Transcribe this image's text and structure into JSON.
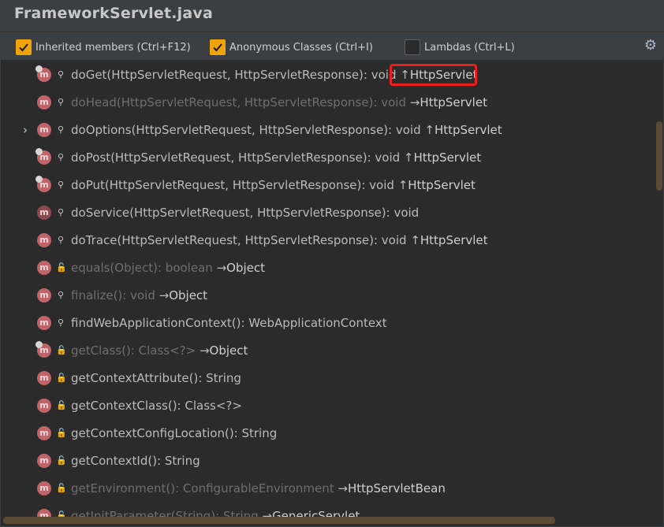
{
  "window": {
    "title": "FrameworkServlet.java"
  },
  "options": [
    {
      "label": "Inherited members (Ctrl+F12)",
      "checked": true
    },
    {
      "label": "Anonymous Classes (Ctrl+I)",
      "checked": true
    },
    {
      "label": "Lambdas (Ctrl+L)",
      "checked": false
    }
  ],
  "settings_icon": "gear-icon",
  "colors": {
    "checkbox_on": "#f0a30a",
    "method_icon": "#c1646a",
    "public_icon": "#62b543",
    "highlight_border": "#e8201e"
  },
  "members": [
    {
      "sig": "doGet(HttpServletRequest, HttpServletResponse): void ",
      "arrow": "↑",
      "owner": "HttpServlet",
      "inherited": false,
      "visibility": "protected",
      "expand": false,
      "override": true
    },
    {
      "sig": "doHead(HttpServletRequest, HttpServletResponse): void ",
      "arrow": "→",
      "owner": "HttpServlet",
      "inherited": true,
      "visibility": "protected",
      "expand": false,
      "override": false
    },
    {
      "sig": "doOptions(HttpServletRequest, HttpServletResponse): void ",
      "arrow": "↑",
      "owner": "HttpServlet",
      "inherited": false,
      "visibility": "protected",
      "expand": true,
      "override": false
    },
    {
      "sig": "doPost(HttpServletRequest, HttpServletResponse): void ",
      "arrow": "↑",
      "owner": "HttpServlet",
      "inherited": false,
      "visibility": "protected",
      "expand": false,
      "override": true
    },
    {
      "sig": "doPut(HttpServletRequest, HttpServletResponse): void ",
      "arrow": "↑",
      "owner": "HttpServlet",
      "inherited": false,
      "visibility": "protected",
      "expand": false,
      "override": true
    },
    {
      "sig": "doService(HttpServletRequest, HttpServletResponse): void",
      "arrow": "",
      "owner": "",
      "inherited": false,
      "visibility": "protected",
      "expand": false,
      "override": false,
      "abstract": true
    },
    {
      "sig": "doTrace(HttpServletRequest, HttpServletResponse): void ",
      "arrow": "↑",
      "owner": "HttpServlet",
      "inherited": false,
      "visibility": "protected",
      "expand": false,
      "override": false
    },
    {
      "sig": "equals(Object): boolean ",
      "arrow": "→",
      "owner": "Object",
      "inherited": true,
      "visibility": "public",
      "expand": false,
      "override": false
    },
    {
      "sig": "finalize(): void ",
      "arrow": "→",
      "owner": "Object",
      "inherited": true,
      "visibility": "protected",
      "expand": false,
      "override": false
    },
    {
      "sig": "findWebApplicationContext(): WebApplicationContext",
      "arrow": "",
      "owner": "",
      "inherited": false,
      "visibility": "protected",
      "expand": false,
      "override": false
    },
    {
      "sig": "getClass(): Class<?> ",
      "arrow": "→",
      "owner": "Object",
      "inherited": true,
      "visibility": "public",
      "expand": false,
      "override": true
    },
    {
      "sig": "getContextAttribute(): String",
      "arrow": "",
      "owner": "",
      "inherited": false,
      "visibility": "public",
      "expand": false,
      "override": false
    },
    {
      "sig": "getContextClass(): Class<?>",
      "arrow": "",
      "owner": "",
      "inherited": false,
      "visibility": "public",
      "expand": false,
      "override": false
    },
    {
      "sig": "getContextConfigLocation(): String",
      "arrow": "",
      "owner": "",
      "inherited": false,
      "visibility": "public",
      "expand": false,
      "override": false
    },
    {
      "sig": "getContextId(): String",
      "arrow": "",
      "owner": "",
      "inherited": false,
      "visibility": "public",
      "expand": false,
      "override": false
    },
    {
      "sig": "getEnvironment(): ConfigurableEnvironment ",
      "arrow": "→",
      "owner": "HttpServletBean",
      "inherited": true,
      "visibility": "public",
      "expand": false,
      "override": false
    },
    {
      "sig": "getInitParameter(String): String ",
      "arrow": "→",
      "owner": "GenericServlet",
      "inherited": true,
      "visibility": "public",
      "expand": false,
      "override": false
    }
  ]
}
